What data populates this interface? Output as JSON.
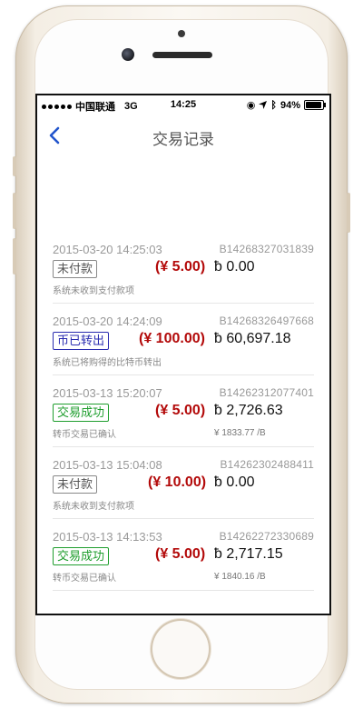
{
  "status_bar": {
    "carrier": "中国联通",
    "network": "3G",
    "time": "14:25",
    "battery": "94%",
    "battery_level": 0.94
  },
  "nav": {
    "back_icon": "chevron-left-icon",
    "title": "交易记录"
  },
  "colors": {
    "accent": "#2255cc",
    "amount": "#b30a0a",
    "unpaid": "#555555",
    "transferred": "#2a2cb0",
    "success": "#1f9e2e"
  },
  "records": [
    {
      "datetime": "2015-03-20 14:25:03",
      "order_no": "B14268327031839",
      "status": "未付款",
      "amount": "(¥ 5.00)",
      "btc": "ƀ 0.00",
      "note": "系统未收到支付款项",
      "rate": ""
    },
    {
      "datetime": "2015-03-20 14:24:09",
      "order_no": "B14268326497668",
      "status": "币已转出",
      "amount": "(¥ 100.00)",
      "btc": "ƀ 60,697.18",
      "note": "系统已将购得的比特币转出",
      "rate": ""
    },
    {
      "datetime": "2015-03-13 15:20:07",
      "order_no": "B14262312077401",
      "status": "交易成功",
      "amount": "(¥ 5.00)",
      "btc": "ƀ 2,726.63",
      "note": "转币交易已确认",
      "rate": "¥ 1833.77 /B"
    },
    {
      "datetime": "2015-03-13 15:04:08",
      "order_no": "B14262302488411",
      "status": "未付款",
      "amount": "(¥ 10.00)",
      "btc": "ƀ 0.00",
      "note": "系统未收到支付款项",
      "rate": ""
    },
    {
      "datetime": "2015-03-13 14:13:53",
      "order_no": "B14262272330689",
      "status": "交易成功",
      "amount": "(¥ 5.00)",
      "btc": "ƀ 2,717.15",
      "note": "转币交易已确认",
      "rate": "¥ 1840.16 /B"
    }
  ]
}
